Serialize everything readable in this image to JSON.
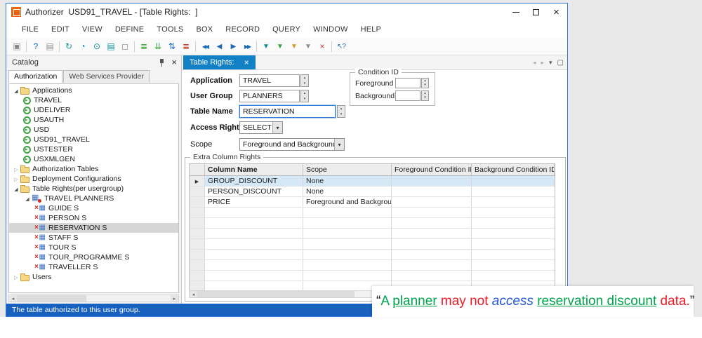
{
  "colors": {
    "accent-blue": "#1180C4",
    "statusbar-blue": "#1861BE",
    "window-border": "#2B7CD3",
    "selection-blue": "#D5E8F8",
    "annotation-green": "#00A24B",
    "annotation-red": "#ED1C24",
    "annotation-blue": "#2456D8",
    "title-icon-orange": "#E8640F"
  },
  "window": {
    "title": "Authorizer  USD91_TRAVEL - [Table Rights:  ]"
  },
  "menu": {
    "items": [
      "FILE",
      "EDIT",
      "VIEW",
      "DEFINE",
      "TOOLS",
      "BOX",
      "RECORD",
      "QUERY",
      "WINDOW",
      "HELP"
    ]
  },
  "toolbar": {
    "icons": [
      {
        "name": "save",
        "glyph": "▣"
      },
      {
        "name": "help",
        "glyph": "?"
      },
      {
        "name": "print",
        "glyph": "▤"
      },
      {
        "name": "refresh",
        "glyph": "↻"
      },
      {
        "name": "history",
        "glyph": "◔"
      },
      {
        "name": "lookup",
        "glyph": "⊙"
      },
      {
        "name": "database",
        "glyph": "▤"
      },
      {
        "name": "clear",
        "glyph": "◻"
      },
      {
        "name": "insert-row",
        "glyph": "≣"
      },
      {
        "name": "duplicate-row",
        "glyph": "⇊"
      },
      {
        "name": "reorder",
        "glyph": "⇅"
      },
      {
        "name": "delete-row",
        "glyph": "≣"
      },
      {
        "name": "first-record",
        "glyph": "◀◀"
      },
      {
        "name": "previous-record",
        "glyph": "◀"
      },
      {
        "name": "next-record",
        "glyph": "▶"
      },
      {
        "name": "last-record",
        "glyph": "▶▶"
      },
      {
        "name": "filter",
        "glyph": "▼"
      },
      {
        "name": "filter-add",
        "glyph": "▼"
      },
      {
        "name": "filter-edit",
        "glyph": "▼"
      },
      {
        "name": "filter-clear",
        "glyph": "▼"
      },
      {
        "name": "remove-filter",
        "glyph": "×"
      },
      {
        "name": "whats-this",
        "glyph": "↖?"
      }
    ]
  },
  "catalog": {
    "title": "Catalog",
    "tabs": [
      {
        "label": "Authorization"
      },
      {
        "label": "Web Services Provider"
      }
    ],
    "tree": [
      {
        "label": "Applications"
      },
      {
        "label": "TRAVEL"
      },
      {
        "label": "UDELIVER"
      },
      {
        "label": "USAUTH"
      },
      {
        "label": "USD"
      },
      {
        "label": "USD91_TRAVEL"
      },
      {
        "label": "USTESTER"
      },
      {
        "label": "USXMLGEN"
      },
      {
        "label": "Authorization Tables"
      },
      {
        "label": "Deployment Configurations"
      },
      {
        "label": "Table Rights(per usergroup)"
      },
      {
        "label": "TRAVEL PLANNERS"
      },
      {
        "label": "GUIDE S"
      },
      {
        "label": "PERSON S"
      },
      {
        "label": "RESERVATION S"
      },
      {
        "label": "STAFF S"
      },
      {
        "label": "TOUR S"
      },
      {
        "label": "TOUR_PROGRAMME S"
      },
      {
        "label": "TRAVELLER S"
      },
      {
        "label": "Users"
      }
    ]
  },
  "tab": {
    "title": "Table Rights:"
  },
  "form": {
    "application": {
      "label": "Application",
      "value": "TRAVEL"
    },
    "user_group": {
      "label": "User Group",
      "value": "PLANNERS"
    },
    "table_name": {
      "label": "Table Name",
      "value": "RESERVATION"
    },
    "access_right": {
      "label": "Access Right",
      "value": "SELECT"
    },
    "scope": {
      "label": "Scope",
      "value": "Foreground and Background"
    },
    "condition_id": {
      "legend": "Condition ID",
      "foreground_label": "Foreground",
      "background_label": "Background",
      "foreground_value": "",
      "background_value": ""
    }
  },
  "grid": {
    "legend": "Extra Column Rights",
    "columns": [
      "Column Name",
      "Scope",
      "Foreground Condition ID",
      "Background Condition ID"
    ],
    "rows": [
      {
        "column_name": "GROUP_DISCOUNT",
        "scope": "None",
        "foreground_condition_id": "",
        "background_condition_id": ""
      },
      {
        "column_name": "PERSON_DISCOUNT",
        "scope": "None",
        "foreground_condition_id": "",
        "background_condition_id": ""
      },
      {
        "column_name": "PRICE",
        "scope": "Foreground and Background",
        "foreground_condition_id": "",
        "background_condition_id": ""
      }
    ]
  },
  "statusbar": {
    "text": "The table authorized to this user group."
  },
  "annotation": {
    "segments": [
      "“",
      "A ",
      "planner",
      " may not ",
      "access ",
      "reservation discount",
      " data.",
      "”"
    ]
  }
}
